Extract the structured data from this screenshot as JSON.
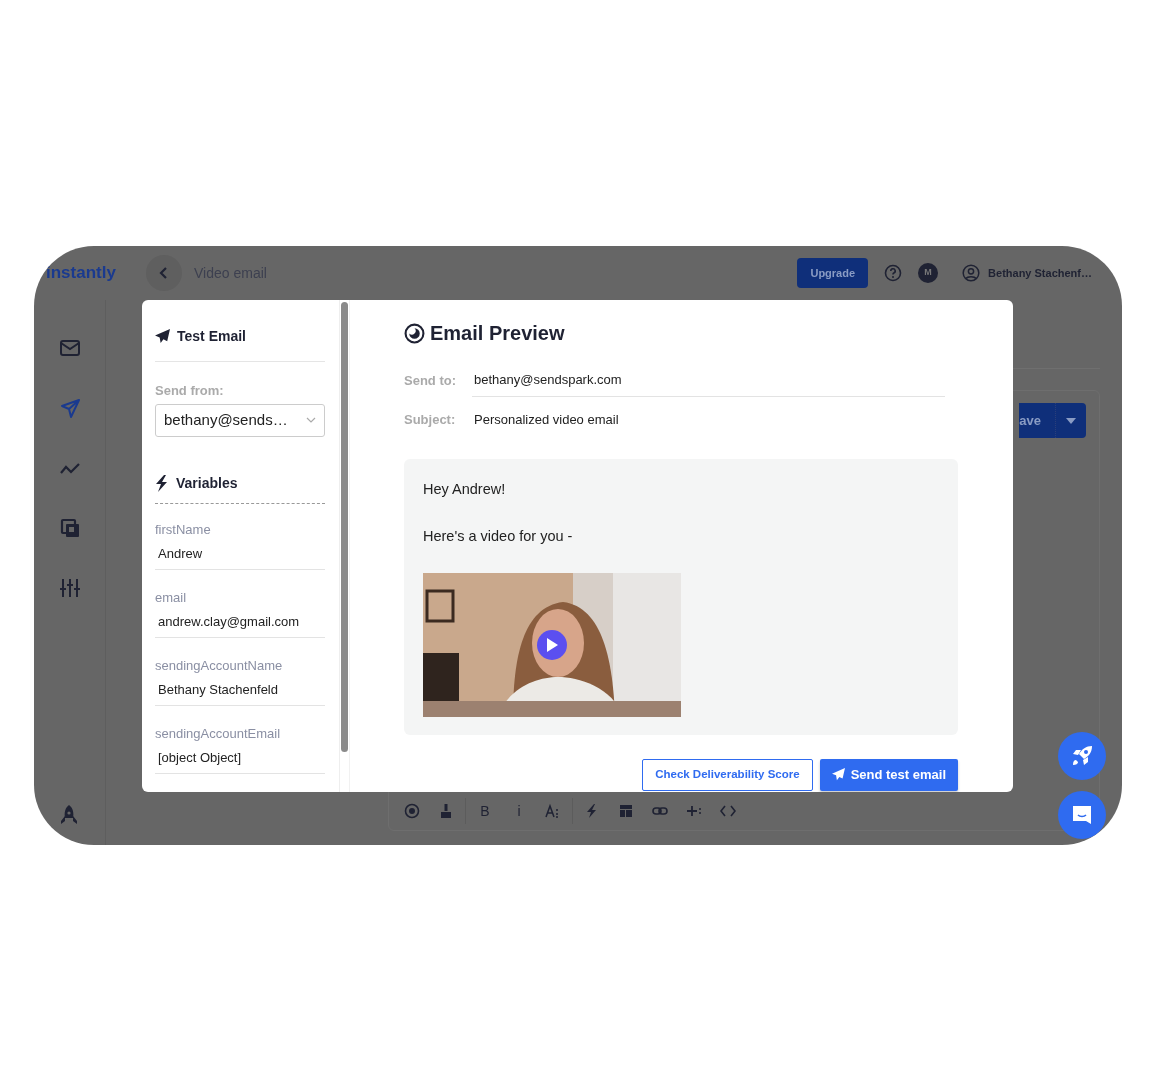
{
  "app": {
    "logo": "instantly",
    "page_title": "Video email",
    "upgrade_button": "Upgrade",
    "avatar_initial": "M",
    "user_name": "Bethany Stachenf…"
  },
  "sidebar": {
    "items": [
      {
        "kind": "mail",
        "selected": false
      },
      {
        "kind": "send",
        "selected": true
      },
      {
        "kind": "chart",
        "selected": false
      },
      {
        "kind": "copy",
        "selected": false
      },
      {
        "kind": "sliders",
        "selected": false
      }
    ]
  },
  "editor": {
    "save_button": "ave",
    "toolbar": [
      {
        "kind": "preview"
      },
      {
        "kind": "brush"
      },
      {
        "kind": "divider"
      },
      {
        "kind": "text",
        "label": "B"
      },
      {
        "kind": "text",
        "label": "i"
      },
      {
        "kind": "fontsize"
      },
      {
        "kind": "divider"
      },
      {
        "kind": "bolt"
      },
      {
        "kind": "layout"
      },
      {
        "kind": "link"
      },
      {
        "kind": "add"
      },
      {
        "kind": "code"
      }
    ]
  },
  "test_email": {
    "title": "Test Email",
    "send_from_label": "Send from:",
    "send_from_value": "bethany@sends…",
    "variables_title": "Variables",
    "variables": [
      {
        "name": "firstName",
        "value": "Andrew"
      },
      {
        "name": "email",
        "value": "andrew.clay@gmail.com"
      },
      {
        "name": "sendingAccountName",
        "value": "Bethany Stachenfeld"
      },
      {
        "name": "sendingAccountEmail",
        "value": "[object Object]"
      }
    ]
  },
  "preview": {
    "title": "Email Preview",
    "send_to_label": "Send to:",
    "send_to": "bethany@sendspark.com",
    "subject_label": "Subject:",
    "subject": "Personalized video email",
    "body": [
      "Hey Andrew!",
      "Here's a video for you -"
    ],
    "check_button": "Check Deliverability Score",
    "send_button": "Send test email"
  }
}
